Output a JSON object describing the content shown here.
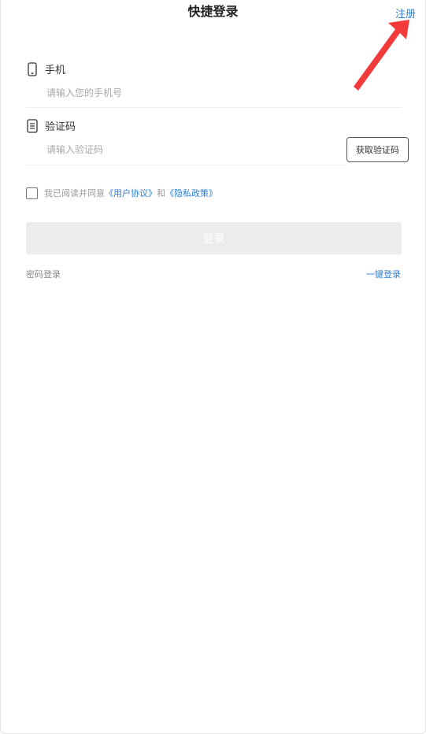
{
  "header": {
    "title": "快捷登录",
    "register_label": "注册"
  },
  "form": {
    "phone": {
      "label": "手机",
      "icon": "phone-icon",
      "placeholder": "请输入您的手机号",
      "value": ""
    },
    "code": {
      "label": "验证码",
      "icon": "document-icon",
      "placeholder": "请输入验证码",
      "value": "",
      "get_code_label": "获取验证码"
    }
  },
  "agreement": {
    "checked": false,
    "prefix": "我已阅读并同意",
    "user_agreement": "《用户协议》",
    "conjunction": "和",
    "privacy_policy": "《隐私政策》"
  },
  "login_button_label": "登录",
  "footer": {
    "password_login": "密码登录",
    "one_click_login": "一键登录"
  },
  "colors": {
    "accent": "#2b7fd6",
    "annotation_arrow": "#f23a3a",
    "login_button_bg": "#ececec"
  }
}
